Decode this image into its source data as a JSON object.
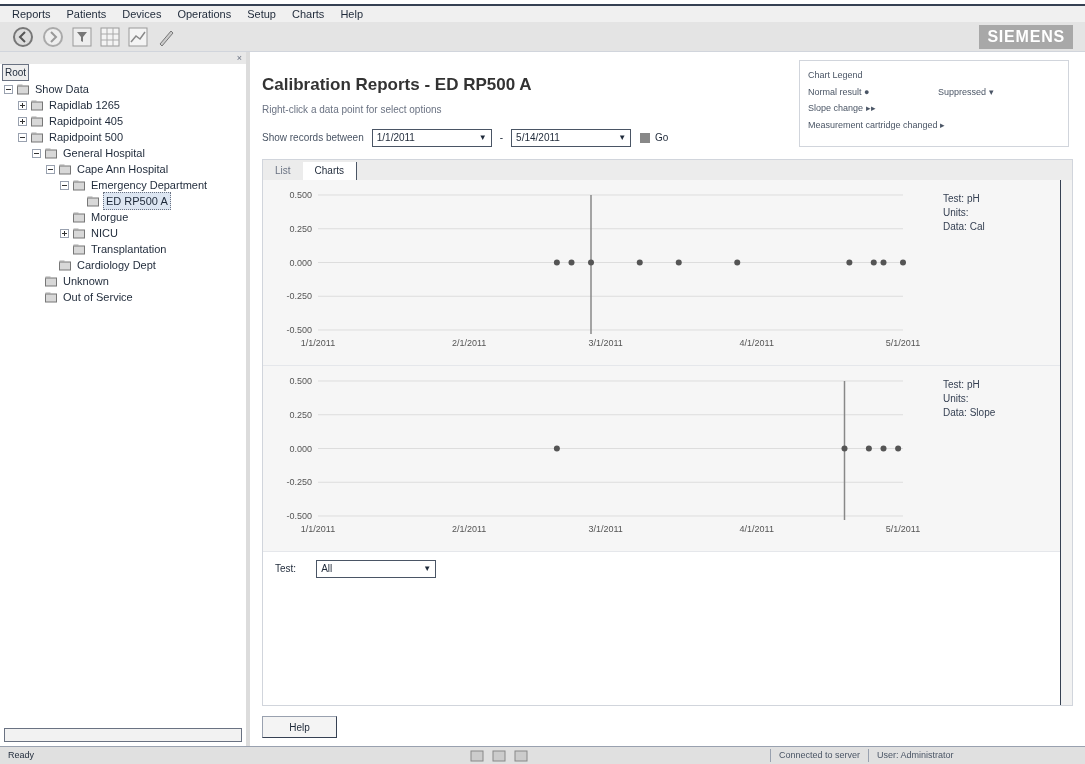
{
  "menu": [
    "Reports",
    "Patients",
    "Devices",
    "Operations",
    "Setup",
    "Charts",
    "Help"
  ],
  "brand": "SIEMENS",
  "tree": {
    "close": "×",
    "root_label": "Root",
    "items": [
      {
        "label": "Show Data",
        "expanded": true,
        "children": [
          {
            "label": "Rapidlab 1265",
            "expanded": false
          },
          {
            "label": "Rapidpoint 405",
            "expanded": false
          },
          {
            "label": "Rapidpoint 500",
            "expanded": true,
            "children": [
              {
                "label": "General Hospital",
                "expanded": true,
                "children": [
                  {
                    "label": "Cape Ann Hospital",
                    "expanded": true,
                    "children": [
                      {
                        "label": "Emergency Department",
                        "expanded": true,
                        "children": [
                          {
                            "label": "ED RP500 A",
                            "selected": true
                          }
                        ]
                      },
                      {
                        "label": "Morgue"
                      },
                      {
                        "label": "NICU",
                        "expanded": false
                      },
                      {
                        "label": "Transplantation"
                      }
                    ]
                  },
                  {
                    "label": "Cardiology Dept"
                  }
                ]
              },
              {
                "label": "Unknown"
              },
              {
                "label": "Out of Service"
              }
            ]
          }
        ]
      }
    ]
  },
  "title": "Calibration Reports - ED RP500 A",
  "subtitle": "Right-click a data point for select options",
  "range": {
    "label": "Show records between",
    "from": {
      "value": "1/1/2011",
      "arrow": "▼"
    },
    "separator": "-",
    "to": {
      "value": "5/14/2011",
      "arrow": "▼"
    },
    "go": "Go"
  },
  "legend": {
    "title": "Chart Legend",
    "items": [
      "Normal result ●",
      "Suppressed ▾",
      "Slope change ▸▸",
      "Measurement cartridge changed ▸"
    ]
  },
  "tabs": [
    {
      "label": "List",
      "selected": false
    },
    {
      "label": "Charts",
      "selected": true
    }
  ],
  "charts": [
    {
      "info": [
        "Test: pH",
        "Units:",
        "Data: Cal"
      ],
      "chart_data": {
        "type": "scatter",
        "x": [
          "2011-02-19",
          "2011-02-22",
          "2011-02-26",
          "2011-03-08",
          "2011-03-16",
          "2011-03-28",
          "2011-04-20",
          "2011-04-25",
          "2011-04-27",
          "2011-05-01"
        ],
        "series": [
          {
            "color": "#555555",
            "values": [
              0,
              0,
              0,
              0,
              0,
              0,
              0,
              0,
              0,
              0
            ]
          }
        ],
        "xlim": [
          "2011-01-01",
          "2011-05-01"
        ],
        "ylim": [
          -0.5,
          0.5
        ],
        "yticks": [
          {
            "value": 0.5,
            "label": "0.500"
          },
          {
            "value": 0.25,
            "label": "0.250"
          },
          {
            "value": 0,
            "label": "0.000"
          },
          {
            "value": -0.25,
            "label": "-0.250"
          },
          {
            "value": -0.5,
            "label": "-0.500"
          }
        ],
        "xticks": [
          {
            "value": "2011-01-01",
            "label": "1/1/2011"
          },
          {
            "value": "2011-02-01",
            "label": "2/1/2011"
          },
          {
            "value": "2011-03-01",
            "label": "3/1/2011"
          },
          {
            "value": "2011-04-01",
            "label": "4/1/2011"
          },
          {
            "value": "2011-05-01",
            "label": "5/1/2011"
          }
        ],
        "grid": true,
        "ref_lines": [
          {
            "axis": "x",
            "value": "2011-02-26"
          }
        ]
      }
    },
    {
      "info": [
        "Test: pH",
        "Units:",
        "Data: Slope"
      ],
      "chart_data": {
        "type": "scatter",
        "x": [
          "2011-02-19",
          "2011-04-19",
          "2011-04-24",
          "2011-04-27",
          "2011-04-30"
        ],
        "series": [
          {
            "color": "#555555",
            "values": [
              0,
              0,
              0,
              0,
              0
            ]
          }
        ],
        "xlim": [
          "2011-01-01",
          "2011-05-01"
        ],
        "ylim": [
          -0.5,
          0.5
        ],
        "yticks": [
          {
            "value": 0.5,
            "label": "0.500"
          },
          {
            "value": 0.25,
            "label": "0.250"
          },
          {
            "value": 0,
            "label": "0.000"
          },
          {
            "value": -0.25,
            "label": "-0.250"
          },
          {
            "value": -0.5,
            "label": "-0.500"
          }
        ],
        "xticks": [
          {
            "value": "2011-01-01",
            "label": "1/1/2011"
          },
          {
            "value": "2011-02-01",
            "label": "2/1/2011"
          },
          {
            "value": "2011-03-01",
            "label": "3/1/2011"
          },
          {
            "value": "2011-04-01",
            "label": "4/1/2011"
          },
          {
            "value": "2011-05-01",
            "label": "5/1/2011"
          }
        ],
        "grid": true,
        "ref_lines": [
          {
            "axis": "x",
            "value": "2011-04-19"
          }
        ]
      }
    }
  ],
  "test_filter": {
    "label": "Test:",
    "value": "All",
    "arrow": "▼"
  },
  "help_button": "Help",
  "status_bar": {
    "text": "Ready",
    "panes": [
      "Connected to server",
      "User: Administrator"
    ]
  }
}
